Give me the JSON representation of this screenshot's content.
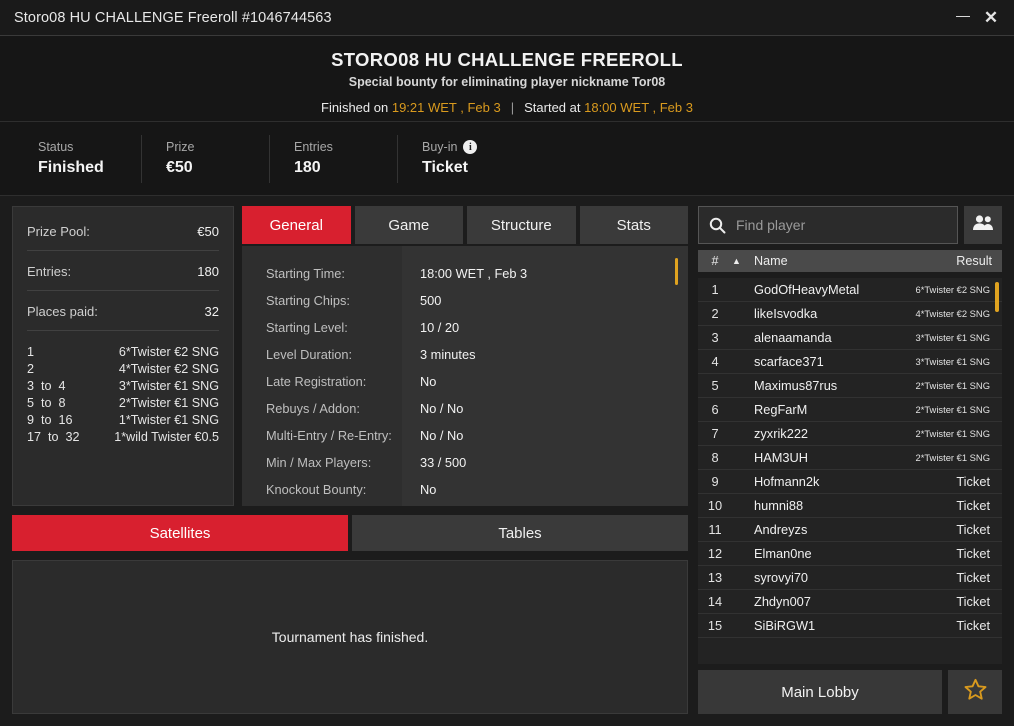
{
  "window": {
    "title": "Storo08 HU CHALLENGE Freeroll #1046744563",
    "minimize_label": "—",
    "close_label": "✕"
  },
  "header": {
    "title": "STORO08 HU CHALLENGE FREEROLL",
    "subtitle": "Special bounty for eliminating player nickname Tor08",
    "finished_prefix": "Finished on",
    "finished_value": "19:21 WET , Feb 3",
    "separator": "|",
    "started_prefix": "Started at",
    "started_value": "18:00 WET , Feb 3"
  },
  "stats": [
    {
      "label": "Status",
      "value": "Finished",
      "has_info": false
    },
    {
      "label": "Prize",
      "value": "€50",
      "has_info": false
    },
    {
      "label": "Entries",
      "value": "180",
      "has_info": false
    },
    {
      "label": "Buy-in",
      "value": "Ticket",
      "has_info": true
    }
  ],
  "prize_pool": {
    "rows": [
      {
        "label": "Prize Pool:",
        "value": "€50"
      },
      {
        "label": "Entries:",
        "value": "180"
      },
      {
        "label": "Places paid:",
        "value": "32"
      }
    ],
    "payouts": [
      {
        "position": "1",
        "prize": "6*Twister €2 SNG"
      },
      {
        "position": "2",
        "prize": "4*Twister €2 SNG"
      },
      {
        "position": "3  to  4",
        "prize": "3*Twister €1 SNG"
      },
      {
        "position": "5  to  8",
        "prize": "2*Twister €1 SNG"
      },
      {
        "position": "9  to  16",
        "prize": "1*Twister €1 SNG"
      },
      {
        "position": "17  to  32",
        "prize": "1*wild Twister €0.5"
      }
    ]
  },
  "tabs": [
    {
      "label": "General",
      "active": true
    },
    {
      "label": "Game",
      "active": false
    },
    {
      "label": "Structure",
      "active": false
    },
    {
      "label": "Stats",
      "active": false
    }
  ],
  "general_info": [
    {
      "label": "Starting Time:",
      "value": "18:00 WET , Feb 3"
    },
    {
      "label": "Starting Chips:",
      "value": "500"
    },
    {
      "label": "Starting Level:",
      "value": "10 / 20"
    },
    {
      "label": "Level Duration:",
      "value": "3 minutes"
    },
    {
      "label": "Late Registration:",
      "value": "No"
    },
    {
      "label": "Rebuys / Addon:",
      "value": "No / No"
    },
    {
      "label": "Multi-Entry / Re-Entry:",
      "value": "No / No"
    },
    {
      "label": "Min / Max Players:",
      "value": "33 / 500"
    },
    {
      "label": "Knockout Bounty:",
      "value": "No"
    }
  ],
  "lower_tabs": [
    {
      "label": "Satellites",
      "active": true
    },
    {
      "label": "Tables",
      "active": false
    }
  ],
  "lower_panel": {
    "message": "Tournament has finished."
  },
  "search": {
    "placeholder": "Find player",
    "value": "",
    "icon": "search-icon",
    "people_icon": "people-icon"
  },
  "player_table": {
    "columns": {
      "num": "#",
      "sort": "▲",
      "name": "Name",
      "result": "Result"
    },
    "rows": [
      {
        "num": "1",
        "name": "GodOfHeavyMetal",
        "result": "6*Twister €2 SNG",
        "small": true
      },
      {
        "num": "2",
        "name": "likeIsvodka",
        "result": "4*Twister €2 SNG",
        "small": true
      },
      {
        "num": "3",
        "name": "alenaamanda",
        "result": "3*Twister €1 SNG",
        "small": true
      },
      {
        "num": "4",
        "name": "scarface371",
        "result": "3*Twister €1 SNG",
        "small": true
      },
      {
        "num": "5",
        "name": "Maximus87rus",
        "result": "2*Twister €1 SNG",
        "small": true
      },
      {
        "num": "6",
        "name": "RegFarM",
        "result": "2*Twister €1 SNG",
        "small": true
      },
      {
        "num": "7",
        "name": "zyxrik222",
        "result": "2*Twister €1 SNG",
        "small": true
      },
      {
        "num": "8",
        "name": "HAM3UH",
        "result": "2*Twister €1 SNG",
        "small": true
      },
      {
        "num": "9",
        "name": "Hofmann2k",
        "result": "Ticket",
        "small": false
      },
      {
        "num": "10",
        "name": "humni88",
        "result": "Ticket",
        "small": false
      },
      {
        "num": "11",
        "name": "Andreyzs",
        "result": "Ticket",
        "small": false
      },
      {
        "num": "12",
        "name": "Elman0ne",
        "result": "Ticket",
        "small": false
      },
      {
        "num": "13",
        "name": "syrovyi70",
        "result": "Ticket",
        "small": false
      },
      {
        "num": "14",
        "name": "Zhdyn007",
        "result": "Ticket",
        "small": false
      },
      {
        "num": "15",
        "name": "SiBiRGW1",
        "result": "Ticket",
        "small": false
      }
    ]
  },
  "footer": {
    "lobby_label": "Main Lobby",
    "favorite_icon": "star-icon"
  },
  "colors": {
    "accent_red": "#d8202f",
    "gold": "#d99a1e",
    "scrollbar": "#e0a320",
    "bg_dark": "#1c1c1c",
    "panel": "#2b2b2b"
  }
}
